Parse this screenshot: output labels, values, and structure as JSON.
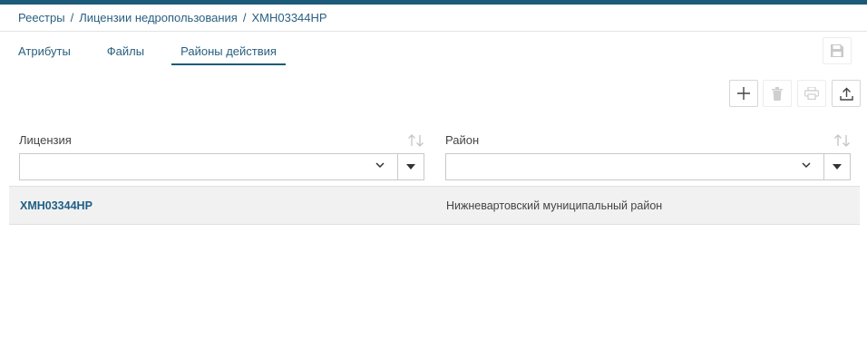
{
  "breadcrumb": {
    "items": [
      "Реестры",
      "Лицензии недропользования",
      "ХМН03344НР"
    ],
    "separator": "/"
  },
  "tabs": [
    {
      "label": "Атрибуты",
      "active": false
    },
    {
      "label": "Файлы",
      "active": false
    },
    {
      "label": "Районы действия",
      "active": true
    }
  ],
  "toolbar": {
    "save_icon": "save-icon",
    "add_icon": "plus-icon",
    "delete_icon": "trash-icon",
    "print_icon": "printer-icon",
    "export_icon": "upload-icon"
  },
  "table": {
    "columns": [
      {
        "label": "Лицензия",
        "filter_value": ""
      },
      {
        "label": "Район",
        "filter_value": ""
      }
    ],
    "rows": [
      {
        "license": "ХМН03344НР",
        "district": "Нижневартовский муниципальный район"
      }
    ]
  },
  "colors": {
    "accent": "#1c5a7a",
    "link": "#2a5f80",
    "row_bg": "#f1f1f1"
  }
}
